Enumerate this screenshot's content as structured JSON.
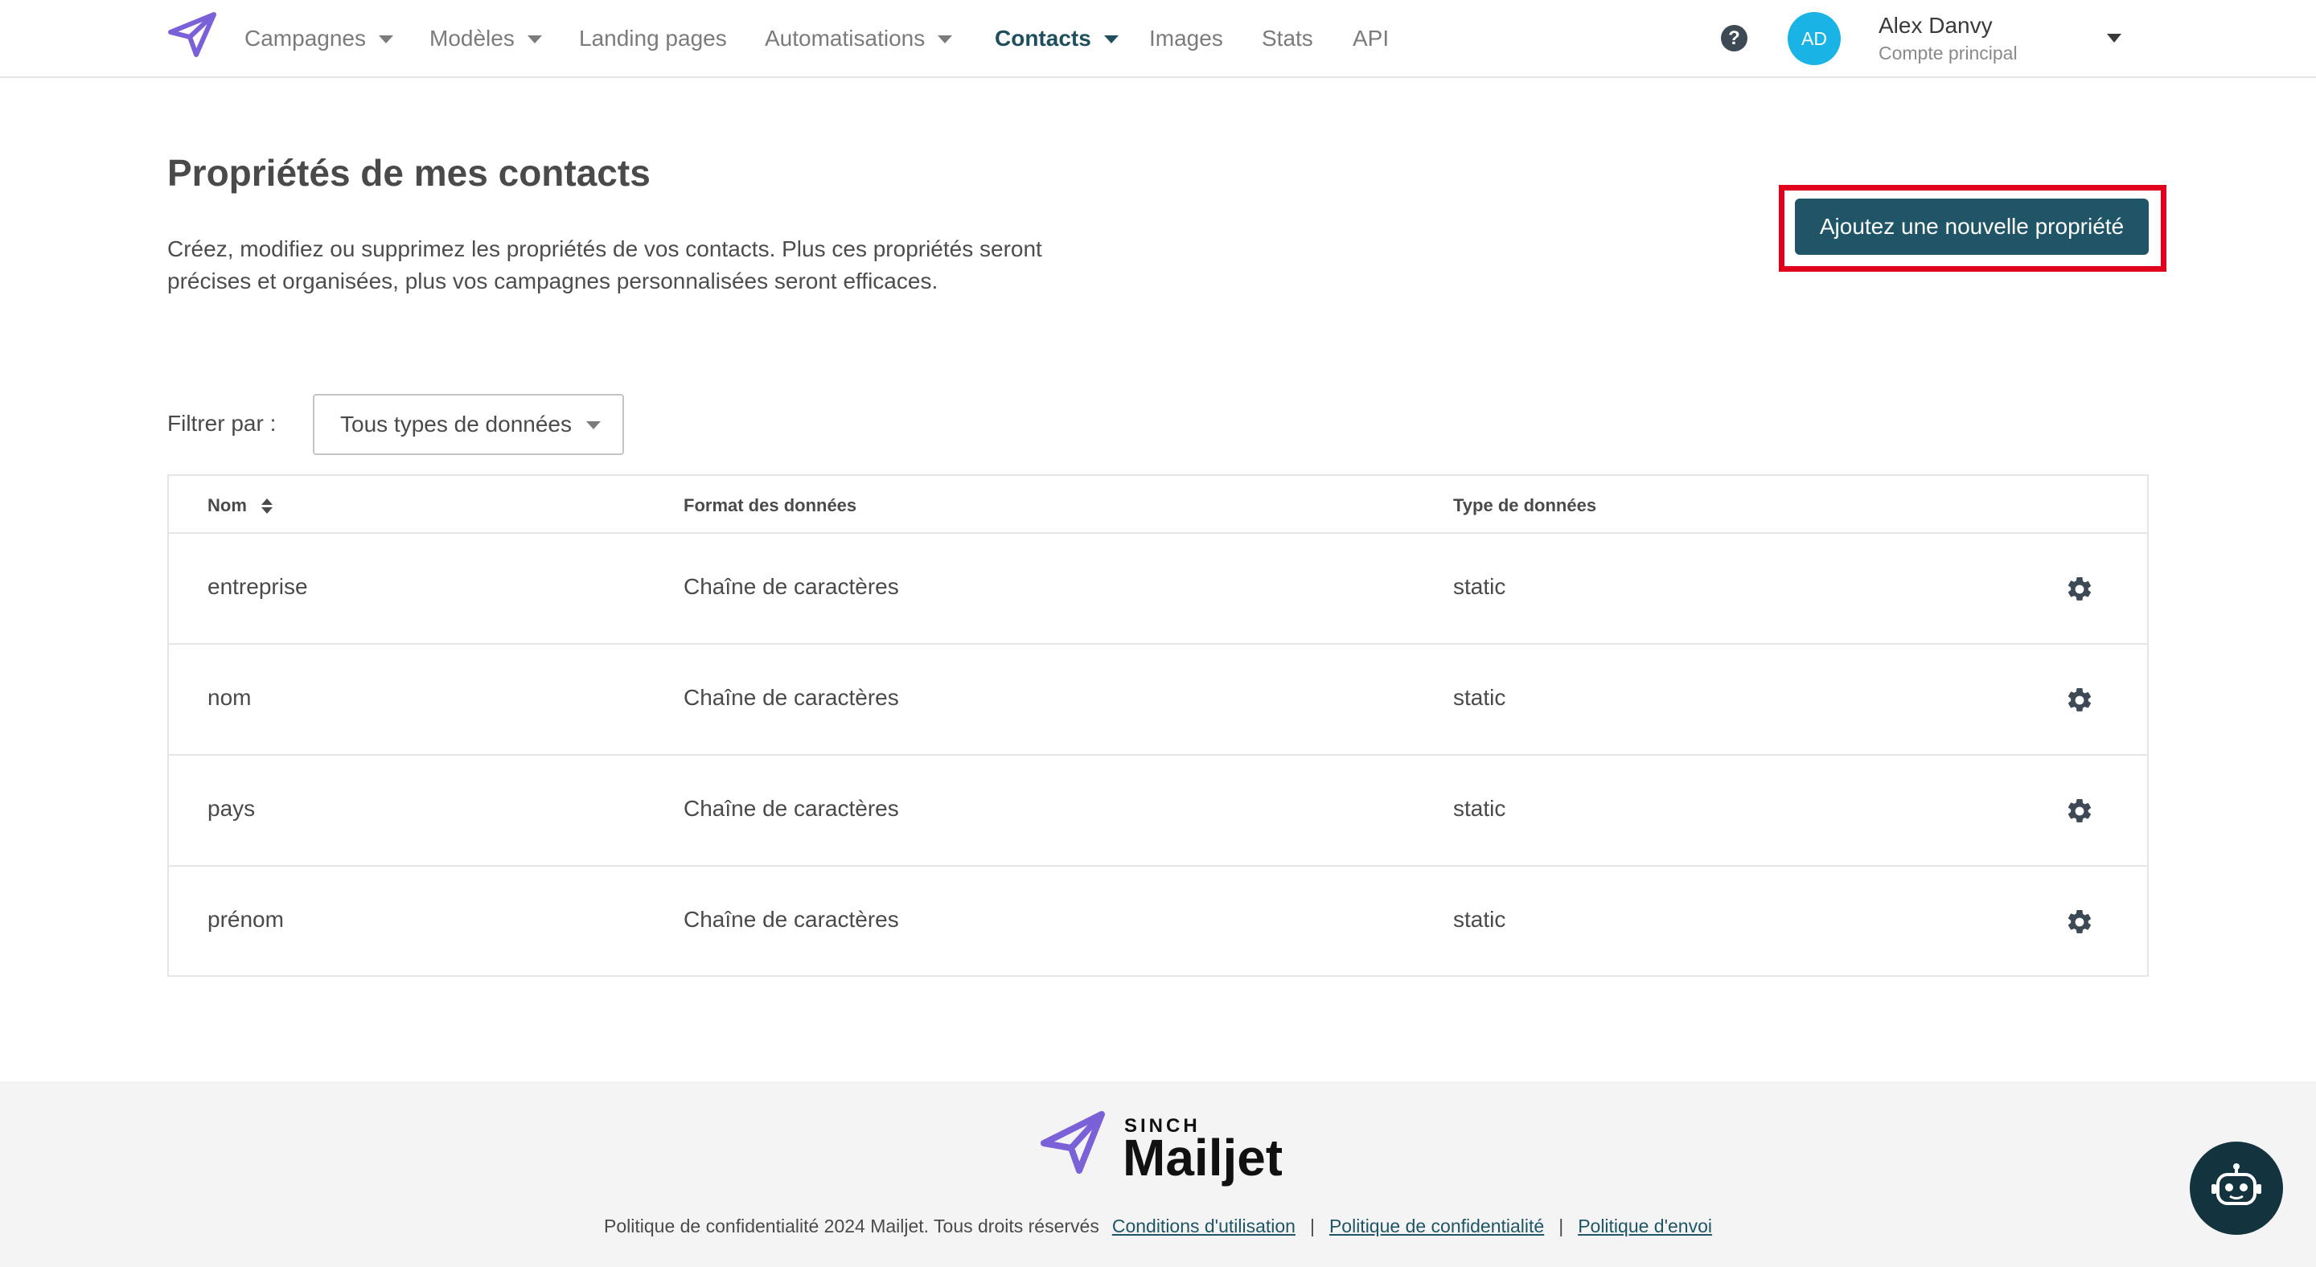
{
  "nav": {
    "items": [
      {
        "label": "Campagnes",
        "dropdown": true,
        "active": false
      },
      {
        "label": "Modèles",
        "dropdown": true,
        "active": false
      },
      {
        "label": "Landing pages",
        "dropdown": false,
        "active": false
      },
      {
        "label": "Automatisations",
        "dropdown": true,
        "active": false
      },
      {
        "label": "Contacts",
        "dropdown": true,
        "active": true
      },
      {
        "label": "Images",
        "dropdown": false,
        "active": false
      },
      {
        "label": "Stats",
        "dropdown": false,
        "active": false
      },
      {
        "label": "API",
        "dropdown": false,
        "active": false
      }
    ],
    "help_glyph": "?",
    "user": {
      "initials": "AD",
      "name": "Alex Danvy",
      "account": "Compte principal"
    }
  },
  "header": {
    "title": "Propriétés de mes contacts",
    "description": "Créez, modifiez ou supprimez les propriétés de vos contacts. Plus ces propriétés seront précises et organisées, plus vos campagnes personnalisées seront efficaces.",
    "add_button": "Ajoutez une nouvelle propriété"
  },
  "filter": {
    "label": "Filtrer par :",
    "selected": "Tous types de données"
  },
  "table": {
    "columns": [
      "Nom",
      "Format des données",
      "Type de données"
    ],
    "rows": [
      {
        "name": "entreprise",
        "format": "Chaîne de caractères",
        "type": "static"
      },
      {
        "name": "nom",
        "format": "Chaîne de caractères",
        "type": "static"
      },
      {
        "name": "pays",
        "format": "Chaîne de caractères",
        "type": "static"
      },
      {
        "name": "prénom",
        "format": "Chaîne de caractères",
        "type": "static"
      }
    ]
  },
  "footer": {
    "logo_top": "SINCH",
    "logo_main": "Mailjet",
    "copyright": "Politique de confidentialité 2024 Mailjet. Tous droits réservés",
    "links": [
      "Conditions d'utilisation",
      "Politique de confidentialité",
      "Politique d'envoi"
    ],
    "separator": "|"
  },
  "colors": {
    "accent": "#1f5566",
    "active_nav": "#1f4f5c",
    "avatar": "#1ab3e6",
    "highlight": "#e0001b",
    "logo": "#7b61d8",
    "chat": "#13343f"
  },
  "icons": [
    "mailjet-plane-icon",
    "chevron-down-icon",
    "help-icon",
    "sort-icon",
    "gear-icon",
    "chatbot-icon"
  ]
}
